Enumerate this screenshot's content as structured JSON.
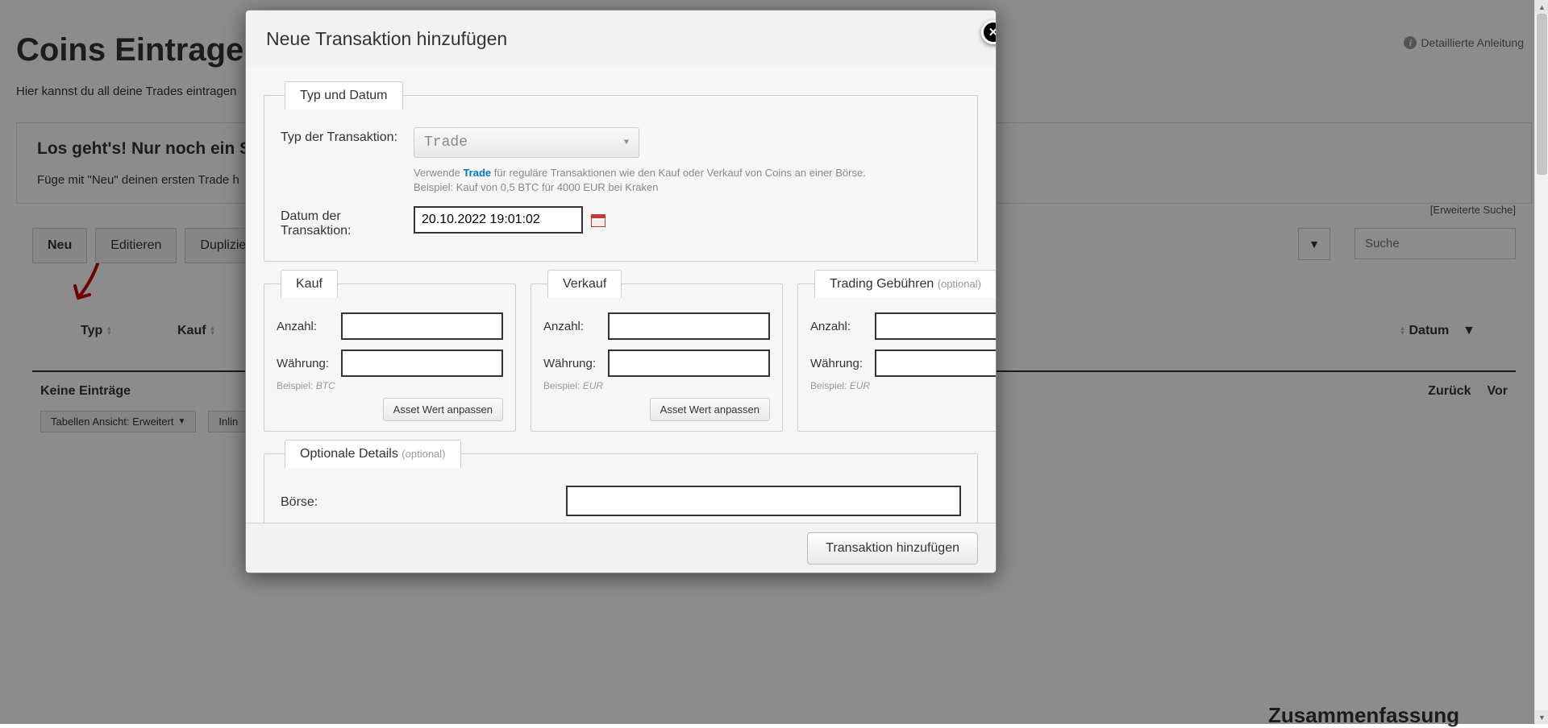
{
  "page": {
    "title": "Coins Eintragen",
    "subtitle": "Hier kannst du all deine Trades eintragen",
    "detailed_link": "Detaillierte Anleitung"
  },
  "panel": {
    "title": "Los geht's! Nur noch ein Sch",
    "text": "Füge mit \"Neu\" deinen ersten Trade h"
  },
  "toolbar": {
    "btn_new": "Neu",
    "btn_edit": "Editieren",
    "btn_dup": "Duplizie",
    "ext_search": "[Erweiterte Suche]",
    "search_placeholder": "Suche"
  },
  "table": {
    "col_typ": "Typ",
    "col_kauf": "Kauf",
    "col_datum": "Datum",
    "no_entries": "Keine Einträge",
    "view_label": "Tabellen Ansicht: Erweitert",
    "inline_label": "Inlin",
    "prev": "Zurück",
    "next": "Vor",
    "summary": "Zusammenfassung"
  },
  "modal": {
    "title": "Neue Transaktion hinzufügen",
    "section_type": "Typ und Datum",
    "label_type": "Typ der Transaktion:",
    "type_value": "Trade",
    "hint_pre": "Verwende ",
    "hint_link": "Trade",
    "hint_post": " für reguläre Transaktionen wie den Kauf oder Verkauf von Coins an einer Börse.",
    "hint_line2": "Beispiel: Kauf von 0,5 BTC für 4000 EUR bei Kraken",
    "label_date": "Datum der Transaktion:",
    "date_value": "20.10.2022 19:01:02",
    "section_buy": "Kauf",
    "section_sell": "Verkauf",
    "section_fee": "Trading Gebühren",
    "optional": "(optional)",
    "label_amount": "Anzahl:",
    "label_currency": "Währung:",
    "hint_btc": "Beispiel:",
    "hint_btc_val": "BTC",
    "hint_eur": "Beispiel:",
    "hint_eur_val": "EUR",
    "asset_btn": "Asset Wert anpassen",
    "section_opt": "Optionale Details",
    "label_exchange": "Börse:",
    "submit": "Transaktion hinzufügen"
  }
}
